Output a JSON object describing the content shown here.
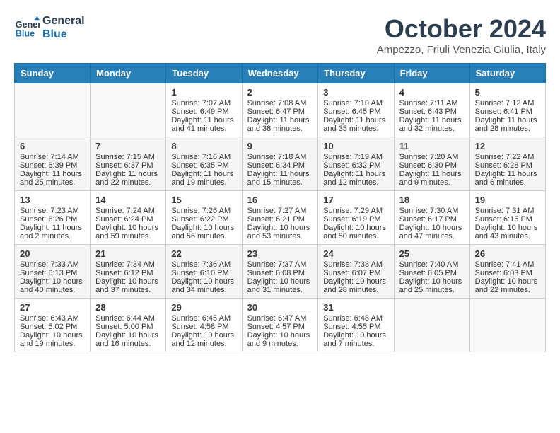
{
  "header": {
    "logo_line1": "General",
    "logo_line2": "Blue",
    "month_title": "October 2024",
    "location": "Ampezzo, Friuli Venezia Giulia, Italy"
  },
  "days_of_week": [
    "Sunday",
    "Monday",
    "Tuesday",
    "Wednesday",
    "Thursday",
    "Friday",
    "Saturday"
  ],
  "weeks": [
    [
      {
        "day": "",
        "info": ""
      },
      {
        "day": "",
        "info": ""
      },
      {
        "day": "1",
        "info": "Sunrise: 7:07 AM\nSunset: 6:49 PM\nDaylight: 11 hours and 41 minutes."
      },
      {
        "day": "2",
        "info": "Sunrise: 7:08 AM\nSunset: 6:47 PM\nDaylight: 11 hours and 38 minutes."
      },
      {
        "day": "3",
        "info": "Sunrise: 7:10 AM\nSunset: 6:45 PM\nDaylight: 11 hours and 35 minutes."
      },
      {
        "day": "4",
        "info": "Sunrise: 7:11 AM\nSunset: 6:43 PM\nDaylight: 11 hours and 32 minutes."
      },
      {
        "day": "5",
        "info": "Sunrise: 7:12 AM\nSunset: 6:41 PM\nDaylight: 11 hours and 28 minutes."
      }
    ],
    [
      {
        "day": "6",
        "info": "Sunrise: 7:14 AM\nSunset: 6:39 PM\nDaylight: 11 hours and 25 minutes."
      },
      {
        "day": "7",
        "info": "Sunrise: 7:15 AM\nSunset: 6:37 PM\nDaylight: 11 hours and 22 minutes."
      },
      {
        "day": "8",
        "info": "Sunrise: 7:16 AM\nSunset: 6:35 PM\nDaylight: 11 hours and 19 minutes."
      },
      {
        "day": "9",
        "info": "Sunrise: 7:18 AM\nSunset: 6:34 PM\nDaylight: 11 hours and 15 minutes."
      },
      {
        "day": "10",
        "info": "Sunrise: 7:19 AM\nSunset: 6:32 PM\nDaylight: 11 hours and 12 minutes."
      },
      {
        "day": "11",
        "info": "Sunrise: 7:20 AM\nSunset: 6:30 PM\nDaylight: 11 hours and 9 minutes."
      },
      {
        "day": "12",
        "info": "Sunrise: 7:22 AM\nSunset: 6:28 PM\nDaylight: 11 hours and 6 minutes."
      }
    ],
    [
      {
        "day": "13",
        "info": "Sunrise: 7:23 AM\nSunset: 6:26 PM\nDaylight: 11 hours and 2 minutes."
      },
      {
        "day": "14",
        "info": "Sunrise: 7:24 AM\nSunset: 6:24 PM\nDaylight: 10 hours and 59 minutes."
      },
      {
        "day": "15",
        "info": "Sunrise: 7:26 AM\nSunset: 6:22 PM\nDaylight: 10 hours and 56 minutes."
      },
      {
        "day": "16",
        "info": "Sunrise: 7:27 AM\nSunset: 6:21 PM\nDaylight: 10 hours and 53 minutes."
      },
      {
        "day": "17",
        "info": "Sunrise: 7:29 AM\nSunset: 6:19 PM\nDaylight: 10 hours and 50 minutes."
      },
      {
        "day": "18",
        "info": "Sunrise: 7:30 AM\nSunset: 6:17 PM\nDaylight: 10 hours and 47 minutes."
      },
      {
        "day": "19",
        "info": "Sunrise: 7:31 AM\nSunset: 6:15 PM\nDaylight: 10 hours and 43 minutes."
      }
    ],
    [
      {
        "day": "20",
        "info": "Sunrise: 7:33 AM\nSunset: 6:13 PM\nDaylight: 10 hours and 40 minutes."
      },
      {
        "day": "21",
        "info": "Sunrise: 7:34 AM\nSunset: 6:12 PM\nDaylight: 10 hours and 37 minutes."
      },
      {
        "day": "22",
        "info": "Sunrise: 7:36 AM\nSunset: 6:10 PM\nDaylight: 10 hours and 34 minutes."
      },
      {
        "day": "23",
        "info": "Sunrise: 7:37 AM\nSunset: 6:08 PM\nDaylight: 10 hours and 31 minutes."
      },
      {
        "day": "24",
        "info": "Sunrise: 7:38 AM\nSunset: 6:07 PM\nDaylight: 10 hours and 28 minutes."
      },
      {
        "day": "25",
        "info": "Sunrise: 7:40 AM\nSunset: 6:05 PM\nDaylight: 10 hours and 25 minutes."
      },
      {
        "day": "26",
        "info": "Sunrise: 7:41 AM\nSunset: 6:03 PM\nDaylight: 10 hours and 22 minutes."
      }
    ],
    [
      {
        "day": "27",
        "info": "Sunrise: 6:43 AM\nSunset: 5:02 PM\nDaylight: 10 hours and 19 minutes."
      },
      {
        "day": "28",
        "info": "Sunrise: 6:44 AM\nSunset: 5:00 PM\nDaylight: 10 hours and 16 minutes."
      },
      {
        "day": "29",
        "info": "Sunrise: 6:45 AM\nSunset: 4:58 PM\nDaylight: 10 hours and 12 minutes."
      },
      {
        "day": "30",
        "info": "Sunrise: 6:47 AM\nSunset: 4:57 PM\nDaylight: 10 hours and 9 minutes."
      },
      {
        "day": "31",
        "info": "Sunrise: 6:48 AM\nSunset: 4:55 PM\nDaylight: 10 hours and 7 minutes."
      },
      {
        "day": "",
        "info": ""
      },
      {
        "day": "",
        "info": ""
      }
    ]
  ]
}
